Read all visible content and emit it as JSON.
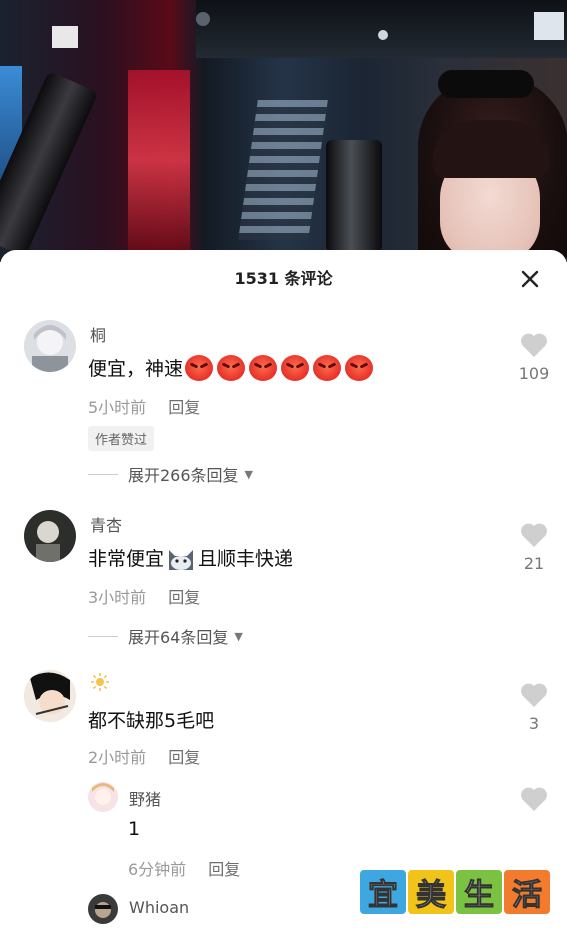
{
  "header": {
    "title": "1531 条评论"
  },
  "comments": [
    {
      "username": "桐",
      "text": "便宜，神速",
      "emoji": "angry-face-emoji",
      "emoji_count": 6,
      "time": "5小时前",
      "reply_label": "回复",
      "badge": "作者赞过",
      "expand_label": "展开266条回复",
      "likes": "109"
    },
    {
      "username": "青杏",
      "text_before": "非常便宜",
      "emoji": "cat-emoji",
      "text_after": "且顺丰快递",
      "time": "3小时前",
      "reply_label": "回复",
      "expand_label": "展开64条回复",
      "likes": "21"
    },
    {
      "username": "",
      "username_icon": "sun-icon",
      "text": "都不缺那5毛吧",
      "time": "2小时前",
      "reply_label": "回复",
      "likes": "3",
      "replies": [
        {
          "username": "野猪",
          "text": "1",
          "time": "6分钟前",
          "reply_label": "回复"
        },
        {
          "username": "Whioan"
        }
      ]
    }
  ],
  "watermark": {
    "chars": [
      "宜",
      "美",
      "生",
      "活"
    ],
    "colors": [
      "#3fa7e0",
      "#f2c318",
      "#7cc242",
      "#f37b2d"
    ]
  },
  "colors": {
    "accent_red": "#e4322a",
    "like_gray": "#cfcfcf"
  }
}
